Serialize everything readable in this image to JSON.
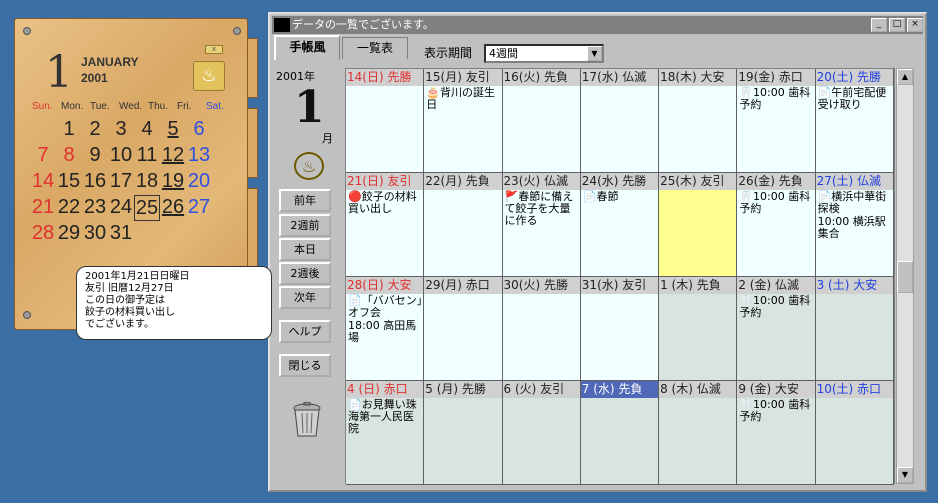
{
  "widget": {
    "day": "1",
    "month_name": "JANUARY",
    "year": "2001",
    "logo_glyph": "♨",
    "close_glyph": "x",
    "weekdays": [
      "Sun.",
      "Mon.",
      "Tue.",
      "Wed.",
      "Thu.",
      "Fri.",
      "Sat."
    ],
    "rows": [
      [
        "",
        "1",
        "2",
        "3",
        "4",
        "5",
        "6"
      ],
      [
        "7",
        "8",
        "9",
        "10",
        "11",
        "12",
        "13"
      ],
      [
        "14",
        "15",
        "16",
        "17",
        "18",
        "19",
        "20"
      ],
      [
        "21",
        "22",
        "23",
        "24",
        "25",
        "26",
        "27"
      ],
      [
        "28",
        "29",
        "30",
        "31",
        "",
        "",
        ""
      ]
    ],
    "tooltip": [
      "2001年1月21日日曜日",
      "友引 旧暦12月27日",
      "この日の御予定は",
      "餃子の材料買い出し",
      "でございます。"
    ]
  },
  "window": {
    "title": "データの一覧でございます。",
    "buttons": {
      "minimize": "_",
      "maximize": "□",
      "close": "×"
    },
    "tabs": [
      "手帳風",
      "一覧表"
    ],
    "period_label": "表示期間",
    "period_value": "4週間",
    "left": {
      "year": "2001年",
      "day": "1",
      "month": "月",
      "logo_glyph": "♨",
      "nav": [
        "前年",
        "2週前",
        "本日",
        "2週後",
        "次年"
      ],
      "help": "ヘルプ",
      "close": "閉じる"
    },
    "weeks": [
      [
        {
          "head": "14(日) 先勝",
          "cls": "sun",
          "bg": "",
          "events": []
        },
        {
          "head": "15(月) 友引",
          "cls": "",
          "bg": "",
          "events": [
            "🎂背川の誕生日"
          ]
        },
        {
          "head": "16(火) 先負",
          "cls": "",
          "bg": "",
          "events": []
        },
        {
          "head": "17(水) 仏滅",
          "cls": "",
          "bg": "",
          "events": []
        },
        {
          "head": "18(木) 大安",
          "cls": "",
          "bg": "",
          "events": []
        },
        {
          "head": "19(金) 赤口",
          "cls": "",
          "bg": "",
          "events": [
            "🦷10:00 歯科予約"
          ]
        },
        {
          "head": "20(土) 先勝",
          "cls": "sat",
          "bg": "",
          "events": [
            "📄午前宅配便受け取り"
          ]
        }
      ],
      [
        {
          "head": "21(日) 友引",
          "cls": "sun",
          "bg": "",
          "events": [
            "🔴餃子の材料買い出し"
          ]
        },
        {
          "head": "22(月) 先負",
          "cls": "",
          "bg": "",
          "events": []
        },
        {
          "head": "23(火) 仏滅",
          "cls": "",
          "bg": "",
          "events": [
            "🚩春節に備えて餃子を大量に作る"
          ]
        },
        {
          "head": "24(水) 先勝",
          "cls": "",
          "bg": "",
          "events": [
            "📄春節"
          ]
        },
        {
          "head": "25(木) 友引",
          "cls": "",
          "bg": "yellow",
          "events": []
        },
        {
          "head": "26(金) 先負",
          "cls": "",
          "bg": "",
          "events": [
            "🦷10:00 歯科予約"
          ]
        },
        {
          "head": "27(土) 仏滅",
          "cls": "sat",
          "bg": "",
          "events": [
            "📄横浜中華街探検",
            "10:00 横浜駅集合"
          ]
        }
      ],
      [
        {
          "head": "28(日) 大安",
          "cls": "sun",
          "bg": "",
          "events": [
            "📄「ババセン」オフ会",
            "18:00 高田馬場"
          ]
        },
        {
          "head": "29(月) 赤口",
          "cls": "",
          "bg": "",
          "events": []
        },
        {
          "head": "30(火) 先勝",
          "cls": "",
          "bg": "",
          "events": []
        },
        {
          "head": "31(水) 友引",
          "cls": "",
          "bg": "",
          "events": []
        },
        {
          "head": "1 (木) 先負",
          "cls": "",
          "bg": "gray",
          "events": []
        },
        {
          "head": "2 (金) 仏滅",
          "cls": "",
          "bg": "gray",
          "events": [
            "🦷10:00 歯科予約"
          ]
        },
        {
          "head": "3 (土) 大安",
          "cls": "sat",
          "bg": "gray",
          "events": []
        }
      ],
      [
        {
          "head": "4 (日) 赤口",
          "cls": "sun",
          "bg": "gray",
          "events": [
            "📄お見舞い珠海第一人民医院"
          ]
        },
        {
          "head": "5 (月) 先勝",
          "cls": "",
          "bg": "gray",
          "events": []
        },
        {
          "head": "6 (火) 友引",
          "cls": "",
          "bg": "gray",
          "events": []
        },
        {
          "head": "7 (水) 先負",
          "cls": "sel",
          "bg": "gray",
          "events": []
        },
        {
          "head": "8 (木) 仏滅",
          "cls": "",
          "bg": "gray",
          "events": []
        },
        {
          "head": "9 (金) 大安",
          "cls": "",
          "bg": "gray",
          "events": [
            "🦷10:00 歯科予約"
          ]
        },
        {
          "head": "10(土) 赤口",
          "cls": "sat",
          "bg": "gray",
          "events": []
        }
      ]
    ],
    "scroll_up": "▲",
    "scroll_down": "▼"
  }
}
